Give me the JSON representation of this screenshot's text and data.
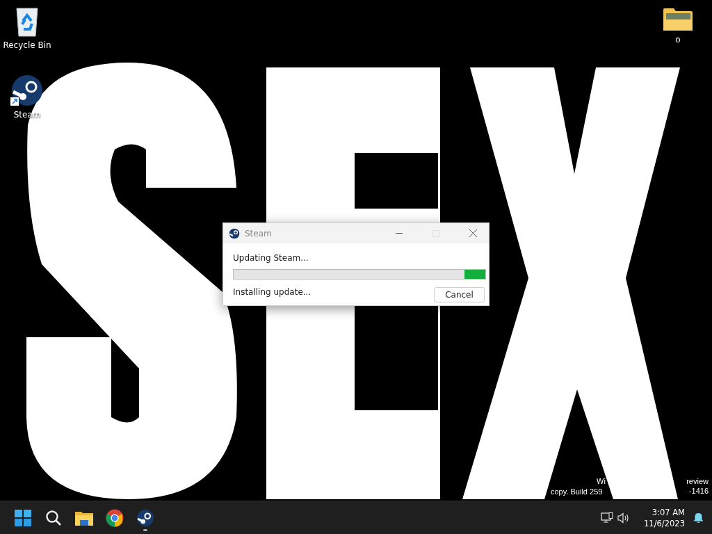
{
  "desktop_icons": [
    {
      "label": "Recycle Bin",
      "kind": "recycle"
    },
    {
      "label": "Steam",
      "kind": "steam"
    },
    {
      "label": "o",
      "kind": "folder"
    }
  ],
  "watermark": {
    "line_1": [
      "Wi",
      "review"
    ],
    "line_2": [
      "copy. Build 259",
      "-1416"
    ]
  },
  "dialog": {
    "title": "Steam",
    "heading": "Updating Steam...",
    "status": "Installing update...",
    "progress": {
      "level": 1
    },
    "buttons": [
      "Cancel"
    ]
  },
  "taskbar": {
    "apps": [
      {
        "kind": "start",
        "running": false
      },
      {
        "kind": "search",
        "running": false
      },
      {
        "kind": "explorer",
        "running": false
      },
      {
        "kind": "chrome",
        "running": false
      },
      {
        "kind": "steam",
        "running": true
      }
    ],
    "time": "3:07 AM",
    "date": "11/6/2023"
  }
}
